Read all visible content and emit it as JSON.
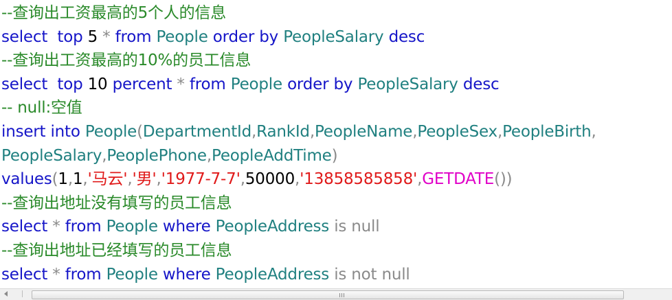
{
  "editor": {
    "lines": [
      {
        "tokens": [
          {
            "c": "comment",
            "t": "--查询出工资最高的5个人的信息"
          }
        ]
      },
      {
        "tokens": [
          {
            "c": "kw",
            "t": "select"
          },
          {
            "c": "plain",
            "t": "  "
          },
          {
            "c": "kw",
            "t": "top"
          },
          {
            "c": "plain",
            "t": " "
          },
          {
            "c": "num",
            "t": "5"
          },
          {
            "c": "plain",
            "t": " "
          },
          {
            "c": "op",
            "t": "*"
          },
          {
            "c": "plain",
            "t": " "
          },
          {
            "c": "kw",
            "t": "from"
          },
          {
            "c": "plain",
            "t": " "
          },
          {
            "c": "id",
            "t": "People"
          },
          {
            "c": "plain",
            "t": " "
          },
          {
            "c": "kw",
            "t": "order by"
          },
          {
            "c": "plain",
            "t": " "
          },
          {
            "c": "id",
            "t": "PeopleSalary"
          },
          {
            "c": "plain",
            "t": " "
          },
          {
            "c": "kw",
            "t": "desc"
          }
        ]
      },
      {
        "tokens": [
          {
            "c": "comment",
            "t": "--查询出工资最高的10%的员工信息"
          }
        ]
      },
      {
        "tokens": [
          {
            "c": "kw",
            "t": "select"
          },
          {
            "c": "plain",
            "t": "  "
          },
          {
            "c": "kw",
            "t": "top"
          },
          {
            "c": "plain",
            "t": " "
          },
          {
            "c": "num",
            "t": "10"
          },
          {
            "c": "plain",
            "t": " "
          },
          {
            "c": "kw",
            "t": "percent"
          },
          {
            "c": "plain",
            "t": " "
          },
          {
            "c": "op",
            "t": "*"
          },
          {
            "c": "plain",
            "t": " "
          },
          {
            "c": "kw",
            "t": "from"
          },
          {
            "c": "plain",
            "t": " "
          },
          {
            "c": "id",
            "t": "People"
          },
          {
            "c": "plain",
            "t": " "
          },
          {
            "c": "kw",
            "t": "order by"
          },
          {
            "c": "plain",
            "t": " "
          },
          {
            "c": "id",
            "t": "PeopleSalary"
          },
          {
            "c": "plain",
            "t": " "
          },
          {
            "c": "kw",
            "t": "desc"
          }
        ]
      },
      {
        "tokens": [
          {
            "c": "comment",
            "t": "-- null:空值"
          }
        ]
      },
      {
        "tokens": [
          {
            "c": "kw",
            "t": "insert into"
          },
          {
            "c": "plain",
            "t": " "
          },
          {
            "c": "id",
            "t": "People"
          },
          {
            "c": "punc",
            "t": "("
          },
          {
            "c": "id",
            "t": "DepartmentId"
          },
          {
            "c": "punc",
            "t": ","
          },
          {
            "c": "id",
            "t": "RankId"
          },
          {
            "c": "punc",
            "t": ","
          },
          {
            "c": "id",
            "t": "PeopleName"
          },
          {
            "c": "punc",
            "t": ","
          },
          {
            "c": "id",
            "t": "PeopleSex"
          },
          {
            "c": "punc",
            "t": ","
          },
          {
            "c": "id",
            "t": "PeopleBirth"
          },
          {
            "c": "punc",
            "t": ","
          }
        ]
      },
      {
        "tokens": [
          {
            "c": "id",
            "t": "PeopleSalary"
          },
          {
            "c": "punc",
            "t": ","
          },
          {
            "c": "id",
            "t": "PeoplePhone"
          },
          {
            "c": "punc",
            "t": ","
          },
          {
            "c": "id",
            "t": "PeopleAddTime"
          },
          {
            "c": "punc",
            "t": ")"
          }
        ]
      },
      {
        "tokens": [
          {
            "c": "kw",
            "t": "values"
          },
          {
            "c": "punc",
            "t": "("
          },
          {
            "c": "num",
            "t": "1"
          },
          {
            "c": "punc",
            "t": ","
          },
          {
            "c": "num",
            "t": "1"
          },
          {
            "c": "punc",
            "t": ","
          },
          {
            "c": "str",
            "t": "'马云'"
          },
          {
            "c": "punc",
            "t": ","
          },
          {
            "c": "str",
            "t": "'男'"
          },
          {
            "c": "punc",
            "t": ","
          },
          {
            "c": "str",
            "t": "'1977-7-7'"
          },
          {
            "c": "punc",
            "t": ","
          },
          {
            "c": "num",
            "t": "50000"
          },
          {
            "c": "punc",
            "t": ","
          },
          {
            "c": "str",
            "t": "'13858585858'"
          },
          {
            "c": "punc",
            "t": ","
          },
          {
            "c": "fn",
            "t": "GETDATE"
          },
          {
            "c": "punc",
            "t": "())"
          }
        ]
      },
      {
        "tokens": [
          {
            "c": "comment",
            "t": "--查询出地址没有填写的员工信息"
          }
        ]
      },
      {
        "tokens": [
          {
            "c": "kw",
            "t": "select"
          },
          {
            "c": "plain",
            "t": " "
          },
          {
            "c": "op",
            "t": "*"
          },
          {
            "c": "plain",
            "t": " "
          },
          {
            "c": "kw",
            "t": "from"
          },
          {
            "c": "plain",
            "t": " "
          },
          {
            "c": "id",
            "t": "People"
          },
          {
            "c": "plain",
            "t": " "
          },
          {
            "c": "kw",
            "t": "where"
          },
          {
            "c": "plain",
            "t": " "
          },
          {
            "c": "id",
            "t": "PeopleAddress"
          },
          {
            "c": "plain",
            "t": " "
          },
          {
            "c": "op",
            "t": "is null"
          }
        ]
      },
      {
        "tokens": [
          {
            "c": "comment",
            "t": "--查询出地址已经填写的员工信息"
          }
        ]
      },
      {
        "tokens": [
          {
            "c": "kw",
            "t": "select"
          },
          {
            "c": "plain",
            "t": " "
          },
          {
            "c": "op",
            "t": "*"
          },
          {
            "c": "plain",
            "t": " "
          },
          {
            "c": "kw",
            "t": "from"
          },
          {
            "c": "plain",
            "t": " "
          },
          {
            "c": "id",
            "t": "People"
          },
          {
            "c": "plain",
            "t": " "
          },
          {
            "c": "kw",
            "t": "where"
          },
          {
            "c": "plain",
            "t": " "
          },
          {
            "c": "id",
            "t": "PeopleAddress"
          },
          {
            "c": "plain",
            "t": " "
          },
          {
            "c": "op",
            "t": "is not null"
          }
        ]
      }
    ]
  },
  "scrollbar": {
    "left_arrow_icon": "arrow-left-icon",
    "grip_icon": "grip-icon"
  }
}
